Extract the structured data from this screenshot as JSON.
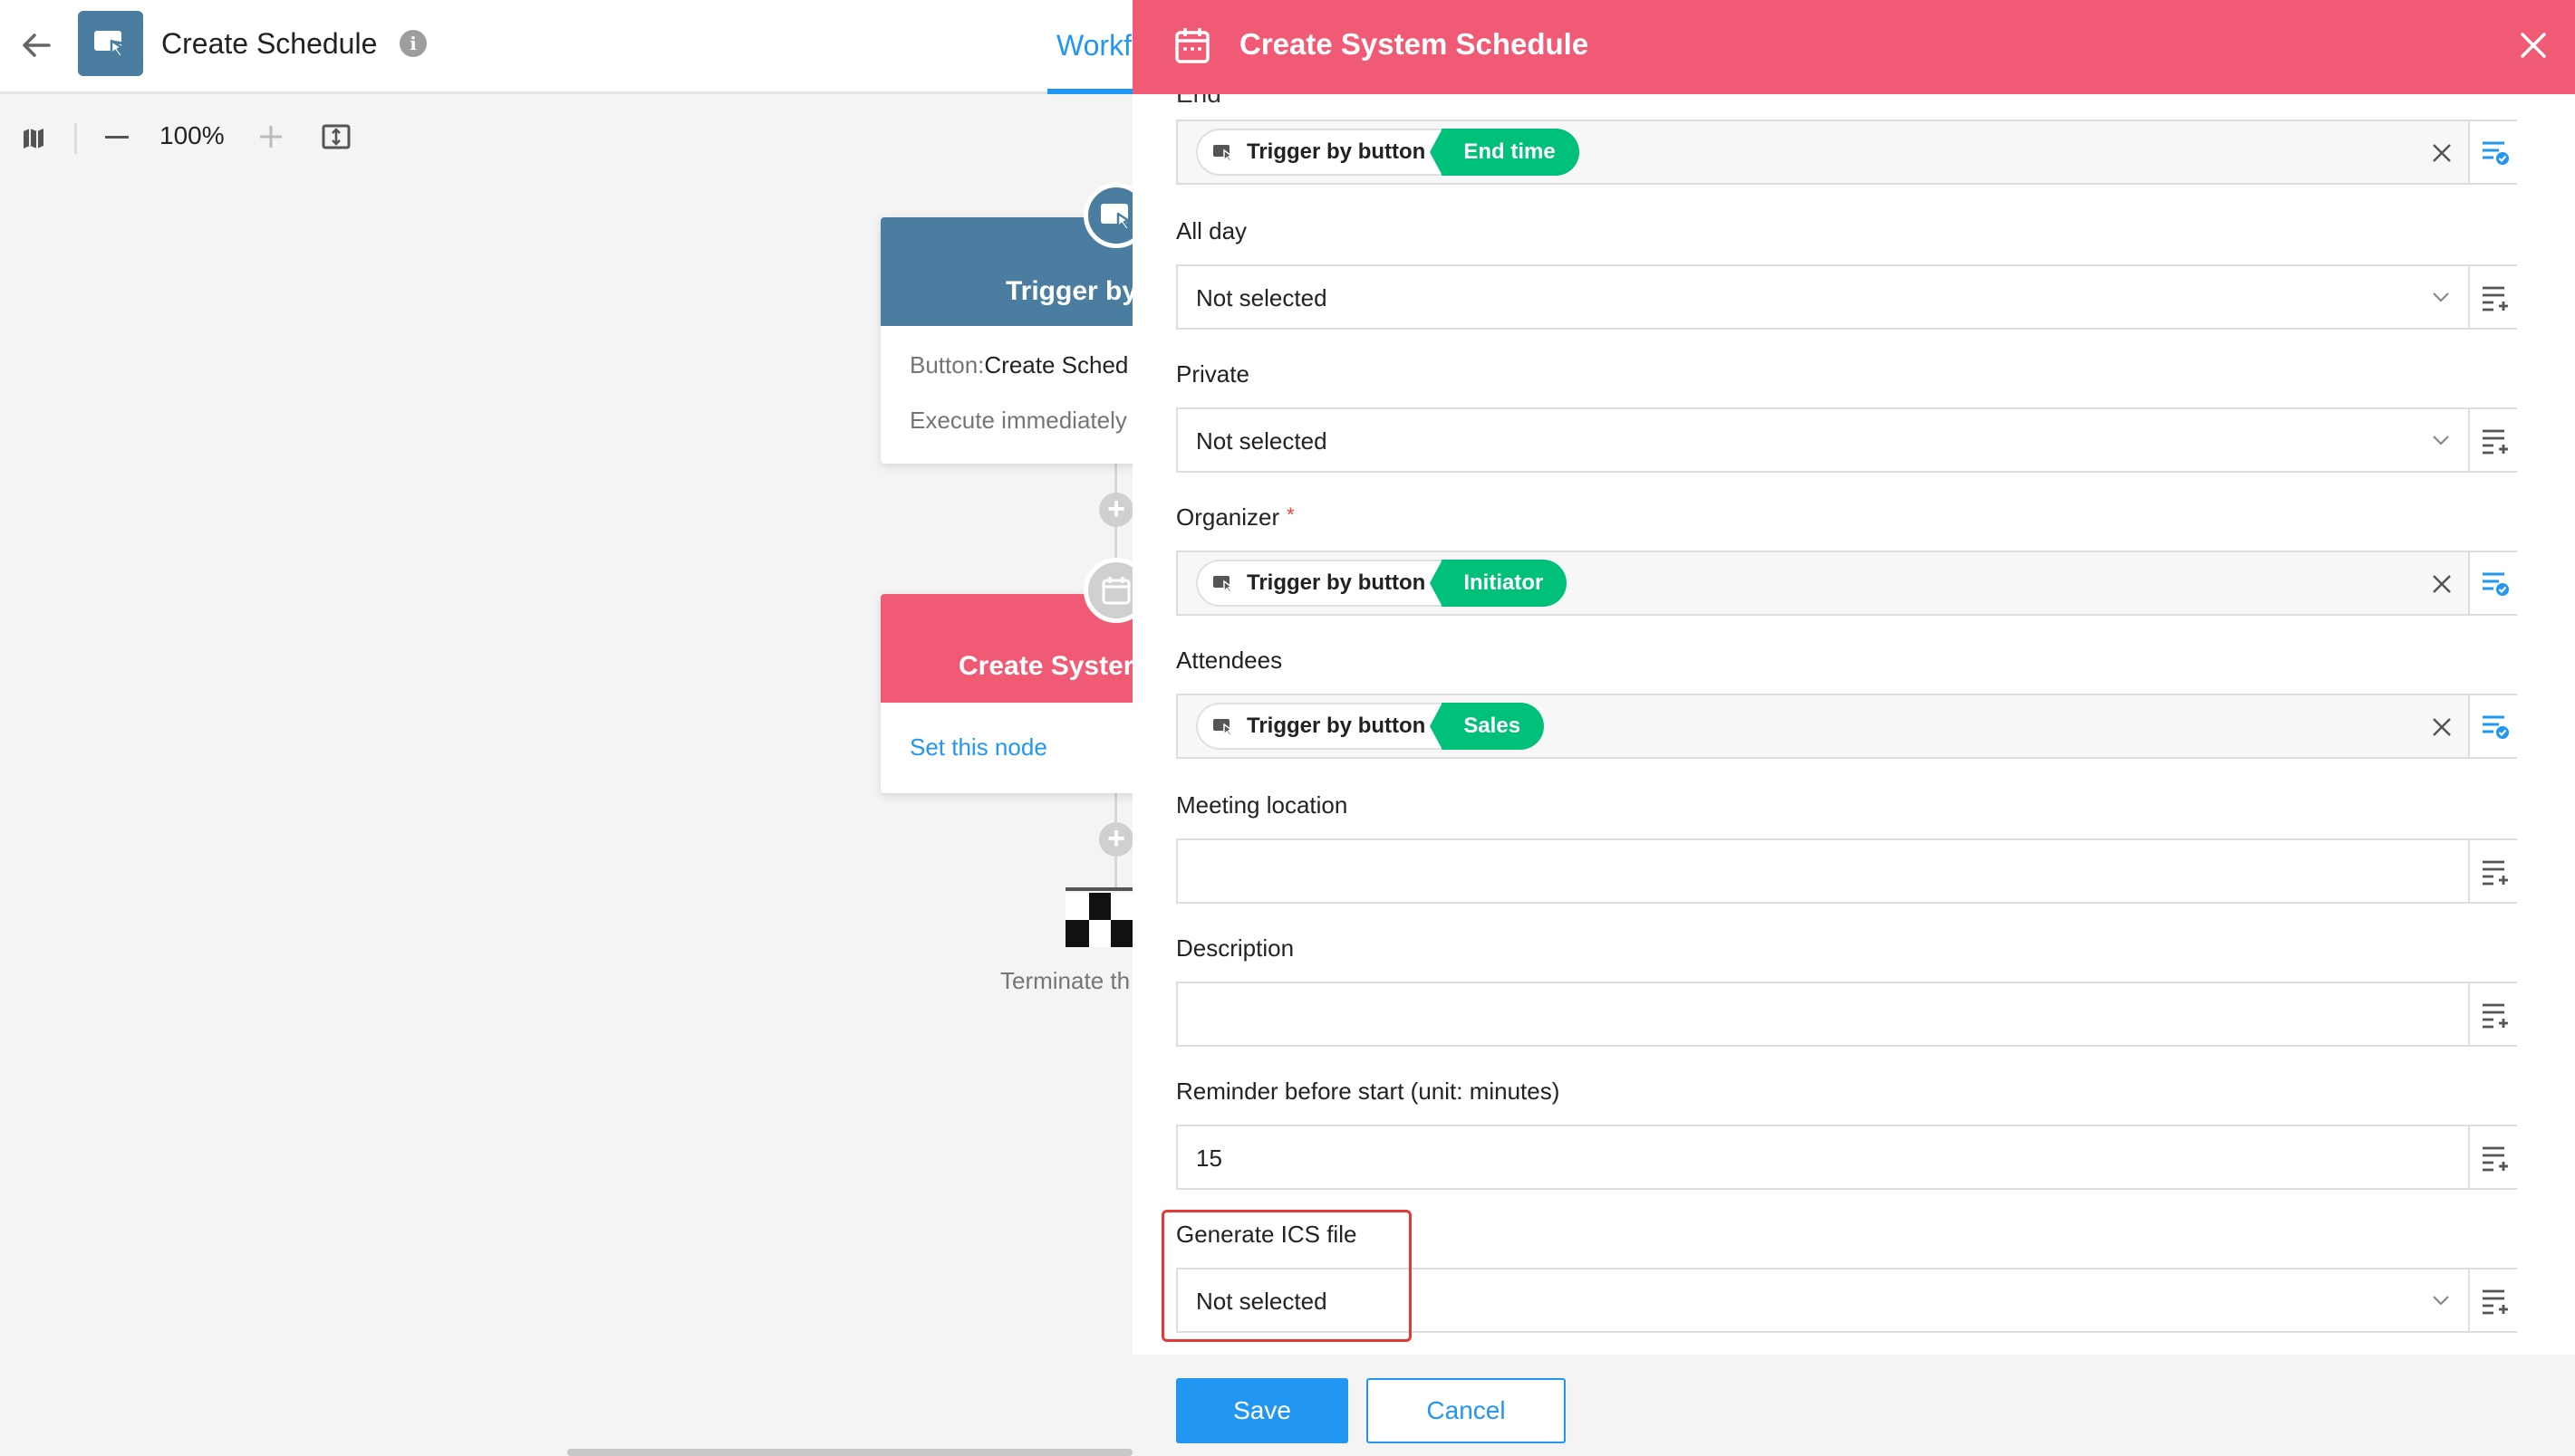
{
  "header": {
    "title": "Create Schedule",
    "workflow_tab": "Workf"
  },
  "toolbar": {
    "zoom": "100%"
  },
  "canvas": {
    "trigger_node": {
      "title": "Trigger by",
      "button_prefix": "Button:",
      "button_value": "Create Sched",
      "exec": "Execute immediately"
    },
    "action_node": {
      "title": "Create Syster",
      "link": "Set this node"
    },
    "end_node": {
      "label": "Terminate th"
    }
  },
  "panel": {
    "title": "Create System Schedule",
    "cut_label": "End",
    "fields": {
      "end": {
        "tag_source": "Trigger by button",
        "tag_field": "End time"
      },
      "all_day": {
        "label": "All day",
        "value": "Not selected"
      },
      "private": {
        "label": "Private",
        "value": "Not selected"
      },
      "organizer": {
        "label": "Organizer",
        "required": "*",
        "tag_source": "Trigger by button",
        "tag_field": "Initiator"
      },
      "attendees": {
        "label": "Attendees",
        "tag_source": "Trigger by button",
        "tag_field": "Sales"
      },
      "meeting_location": {
        "label": "Meeting location",
        "value": ""
      },
      "description": {
        "label": "Description",
        "value": ""
      },
      "reminder": {
        "label": "Reminder before start (unit: minutes)",
        "value": "15"
      },
      "ics": {
        "label": "Generate ICS file",
        "value": "Not selected"
      }
    },
    "save_label": "Save",
    "cancel_label": "Cancel"
  },
  "colors": {
    "panel_header": "#f05a74",
    "tag_green": "#00c07a",
    "primary_blue": "#2196f3",
    "trigger_node": "#4a7da0",
    "highlight_red": "#e53935"
  }
}
